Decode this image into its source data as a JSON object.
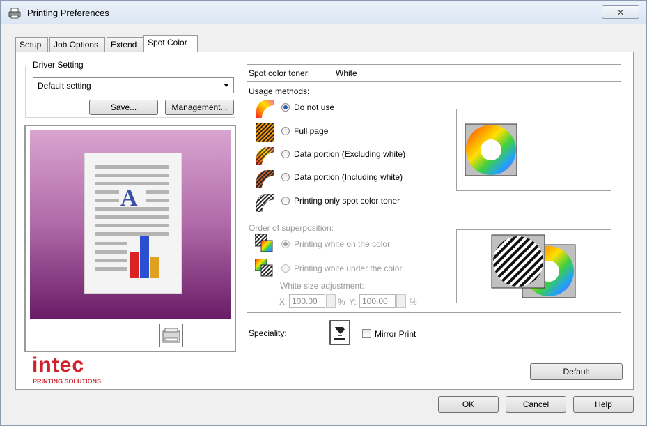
{
  "window": {
    "title": "Printing Preferences",
    "close_glyph": "✕"
  },
  "tabs": [
    {
      "label": "Setup"
    },
    {
      "label": "Job Options"
    },
    {
      "label": "Extend"
    },
    {
      "label": "Spot Color"
    }
  ],
  "driver_setting": {
    "group_label": "Driver Setting",
    "selected": "Default setting",
    "save_label": "Save...",
    "management_label": "Management..."
  },
  "brand": {
    "name": "intec",
    "tagline": "PRINTING SOLUTIONS",
    "color": "#d0202a"
  },
  "spot_color": {
    "toner_label": "Spot color toner:",
    "toner_value": "White",
    "usage_label": "Usage methods:",
    "usage_options": [
      {
        "label": "Do not use",
        "selected": true
      },
      {
        "label": "Full page",
        "selected": false
      },
      {
        "label": "Data portion (Excluding white)",
        "selected": false
      },
      {
        "label": "Data portion (Including white)",
        "selected": false
      },
      {
        "label": "Printing only spot color toner",
        "selected": false
      }
    ],
    "order_label": "Order of superposition:",
    "order_options": [
      {
        "label": "Printing white on the color",
        "selected": true
      },
      {
        "label": "Printing white under the color",
        "selected": false
      }
    ],
    "size_adjust_label": "White size adjustment:",
    "x_label": "X:",
    "x_value": "100.00",
    "y_label": "Y:",
    "y_value": "100.00",
    "percent": "%",
    "speciality_label": "Speciality:",
    "mirror_label": "Mirror Print",
    "default_label": "Default"
  },
  "footer": {
    "ok": "OK",
    "cancel": "Cancel",
    "help": "Help"
  },
  "colors": {
    "accent": "#2a5db0",
    "preview_top": "#d9a4d0",
    "preview_bottom": "#6a1c67"
  }
}
